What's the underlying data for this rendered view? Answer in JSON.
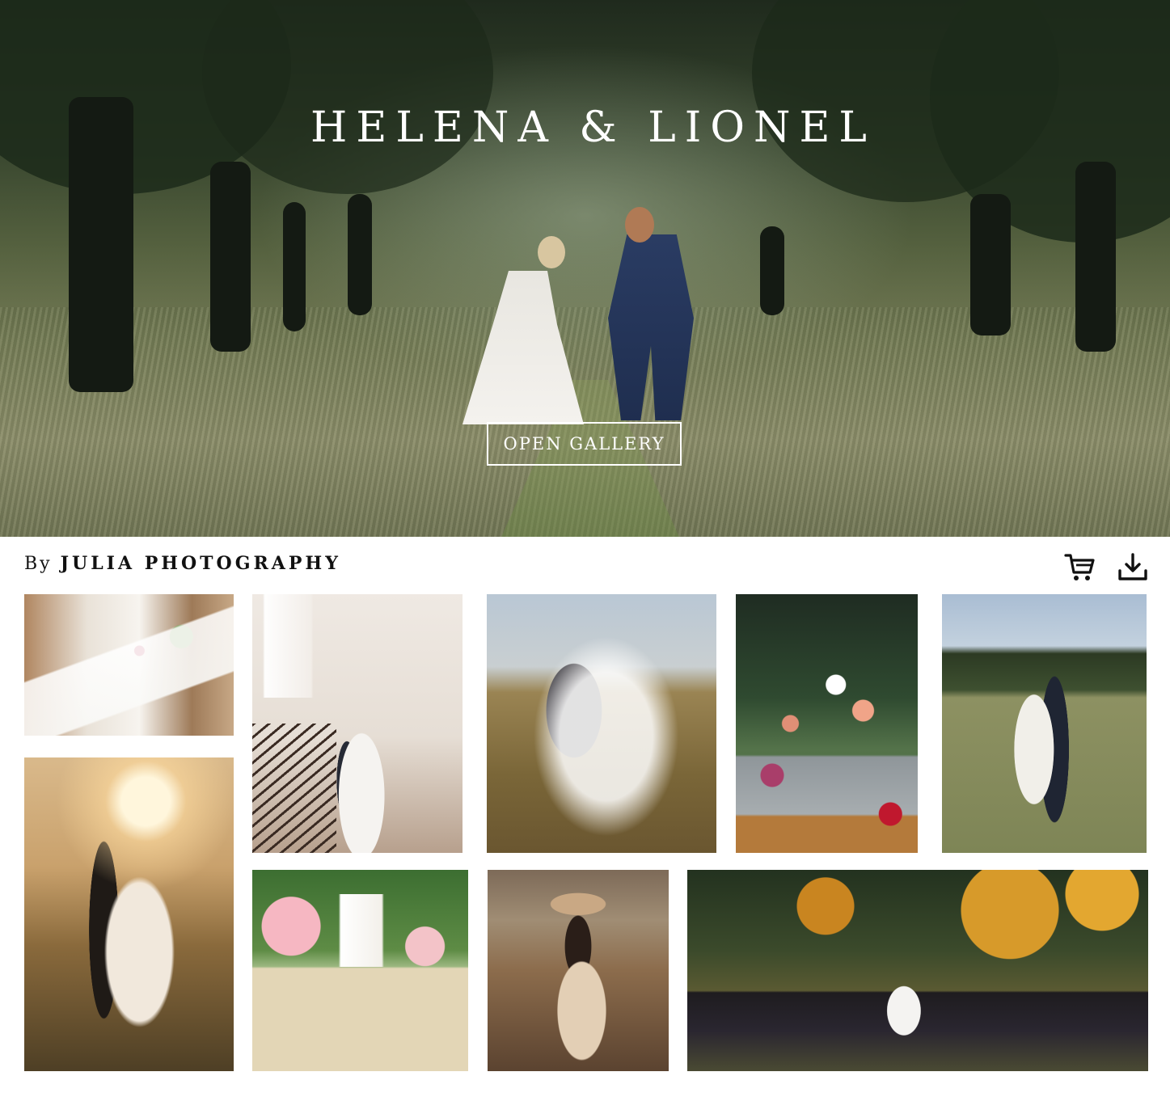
{
  "hero": {
    "title": "HELENA & LIONEL",
    "button_label": "OPEN GALLERY"
  },
  "byline": {
    "prefix": "By",
    "studio": "JULIA PHOTOGRAPHY"
  },
  "actions": {
    "cart_icon": "cart-icon",
    "download_icon": "download-icon"
  },
  "gallery": {
    "photos": [
      {
        "name": "photo-table-setting"
      },
      {
        "name": "photo-couple-staircase"
      },
      {
        "name": "photo-couple-veil-field"
      },
      {
        "name": "photo-flower-buckets"
      },
      {
        "name": "photo-couple-meadow"
      },
      {
        "name": "photo-couple-sunset"
      },
      {
        "name": "photo-ceremony-aisle"
      },
      {
        "name": "photo-woman-hat"
      },
      {
        "name": "photo-outdoor-ceremony"
      }
    ]
  },
  "colors": {
    "text": "#111111",
    "hero_text": "#ffffff",
    "background": "#ffffff"
  }
}
